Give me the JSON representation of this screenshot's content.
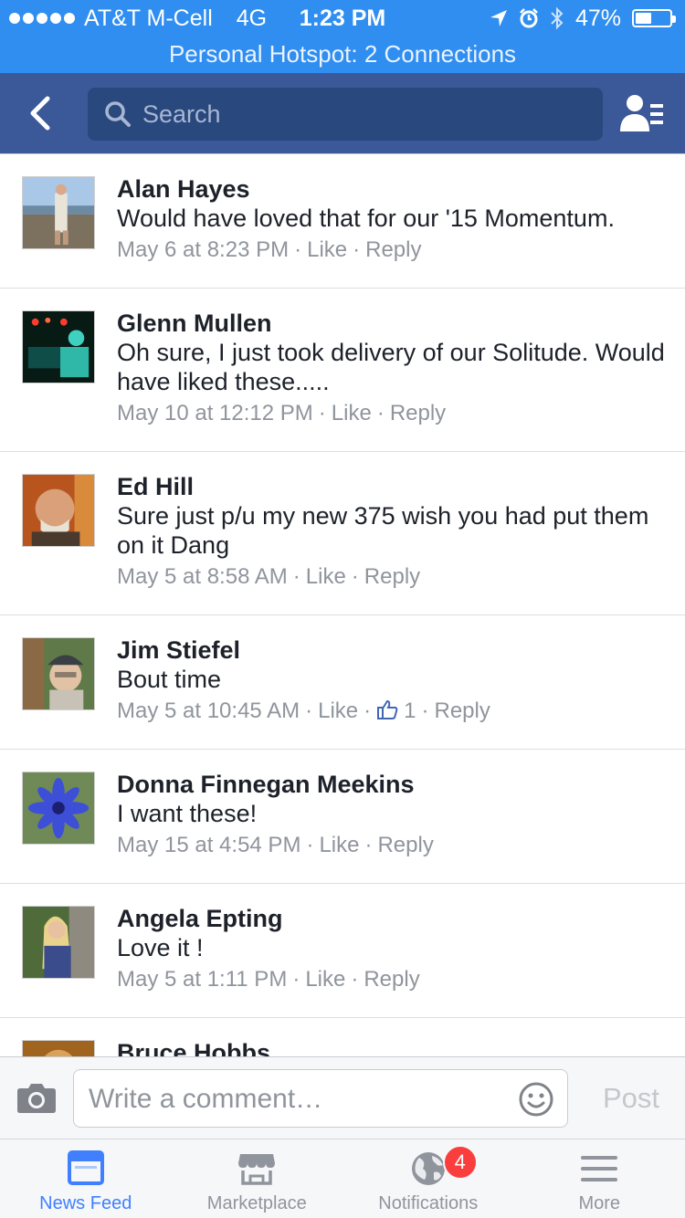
{
  "status_bar": {
    "carrier": "AT&T M-Cell",
    "network": "4G",
    "time": "1:23 PM",
    "battery": "47%",
    "battery_level": 0.47
  },
  "hotspot": {
    "text": "Personal Hotspot: 2 Connections"
  },
  "nav": {
    "search_placeholder": "Search"
  },
  "comments": [
    {
      "author": "Alan Hayes",
      "text": "Would have loved that for our '15 Momentum.",
      "time": "May 6 at 8:23 PM",
      "like": "Like",
      "reply": "Reply"
    },
    {
      "author": "Glenn Mullen",
      "text": "Oh sure, I just took delivery of our Solitude. Would have liked these.....",
      "time": "May 10 at 12:12 PM",
      "like": "Like",
      "reply": "Reply"
    },
    {
      "author": "Ed Hill",
      "text": "Sure just p/u my new 375 wish you had put them on it Dang",
      "time": "May 5 at 8:58 AM",
      "like": "Like",
      "reply": "Reply"
    },
    {
      "author": "Jim Stiefel",
      "text": "Bout time",
      "time": "May 5 at 10:45 AM",
      "like": "Like",
      "like_count": "1",
      "reply": "Reply"
    },
    {
      "author": "Donna Finnegan Meekins",
      "text": "I want these!",
      "time": "May 15 at 4:54 PM",
      "like": "Like",
      "reply": "Reply"
    },
    {
      "author": "Angela Epting",
      "text": "Love it !",
      "time": "May 5 at 1:11 PM",
      "like": "Like",
      "reply": "Reply"
    },
    {
      "author": "Bruce Hobbs"
    }
  ],
  "composer": {
    "placeholder": "Write a comment…",
    "post_label": "Post"
  },
  "tabs": [
    {
      "label": "News Feed",
      "icon": "news-feed-icon",
      "active": true
    },
    {
      "label": "Marketplace",
      "icon": "marketplace-icon"
    },
    {
      "label": "Notifications",
      "icon": "globe-icon",
      "badge": "4"
    },
    {
      "label": "More",
      "icon": "menu-icon"
    }
  ],
  "colors": {
    "status_bar": "#2f8ef0",
    "nav_bar": "#3b5998",
    "search_field": "#29487d",
    "active_tab": "#4080ff",
    "meta_text": "#90949c",
    "badge": "#fa3e3e"
  }
}
